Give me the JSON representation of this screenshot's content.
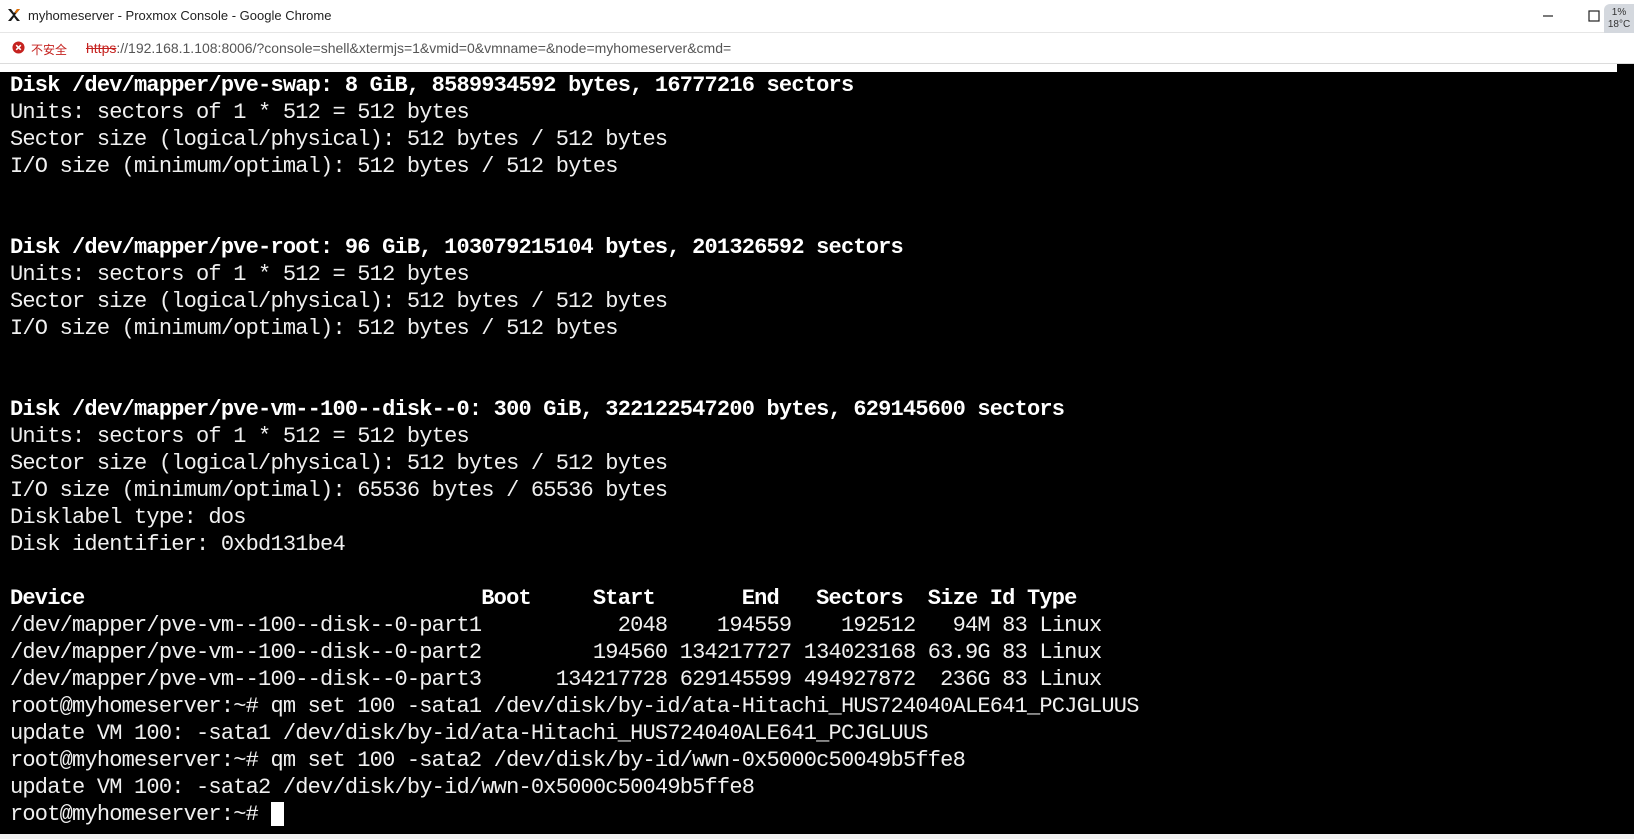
{
  "window": {
    "title": "myhomeserver - Proxmox Console - Google Chrome"
  },
  "weather": {
    "line1": "1%",
    "line2": "18°C"
  },
  "addressbar": {
    "security_label": "不安全",
    "url_scheme": "https",
    "url_rest": "://192.168.1.108:8006/?console=shell&xtermjs=1&vmid=0&vmname=&node=myhomeserver&cmd="
  },
  "terminal": {
    "lines": [
      {
        "text": "Disk /dev/mapper/pve-swap: 8 GiB, 8589934592 bytes, 16777216 sectors",
        "bold": true
      },
      {
        "text": "Units: sectors of 1 * 512 = 512 bytes",
        "bold": false
      },
      {
        "text": "Sector size (logical/physical): 512 bytes / 512 bytes",
        "bold": false
      },
      {
        "text": "I/O size (minimum/optimal): 512 bytes / 512 bytes",
        "bold": false
      },
      {
        "text": "",
        "bold": false
      },
      {
        "text": "",
        "bold": false
      },
      {
        "text": "Disk /dev/mapper/pve-root: 96 GiB, 103079215104 bytes, 201326592 sectors",
        "bold": true
      },
      {
        "text": "Units: sectors of 1 * 512 = 512 bytes",
        "bold": false
      },
      {
        "text": "Sector size (logical/physical): 512 bytes / 512 bytes",
        "bold": false
      },
      {
        "text": "I/O size (minimum/optimal): 512 bytes / 512 bytes",
        "bold": false
      },
      {
        "text": "",
        "bold": false
      },
      {
        "text": "",
        "bold": false
      },
      {
        "text": "Disk /dev/mapper/pve-vm--100--disk--0: 300 GiB, 322122547200 bytes, 629145600 sectors",
        "bold": true
      },
      {
        "text": "Units: sectors of 1 * 512 = 512 bytes",
        "bold": false
      },
      {
        "text": "Sector size (logical/physical): 512 bytes / 512 bytes",
        "bold": false
      },
      {
        "text": "I/O size (minimum/optimal): 65536 bytes / 65536 bytes",
        "bold": false
      },
      {
        "text": "Disklabel type: dos",
        "bold": false
      },
      {
        "text": "Disk identifier: 0xbd131be4",
        "bold": false
      },
      {
        "text": "",
        "bold": false
      },
      {
        "text": "Device                                Boot     Start       End   Sectors  Size Id Type",
        "bold": true
      },
      {
        "text": "/dev/mapper/pve-vm--100--disk--0-part1           2048    194559    192512   94M 83 Linux",
        "bold": false
      },
      {
        "text": "/dev/mapper/pve-vm--100--disk--0-part2         194560 134217727 134023168 63.9G 83 Linux",
        "bold": false
      },
      {
        "text": "/dev/mapper/pve-vm--100--disk--0-part3      134217728 629145599 494927872  236G 83 Linux",
        "bold": false
      },
      {
        "text": "root@myhomeserver:~# qm set 100 -sata1 /dev/disk/by-id/ata-Hitachi_HUS724040ALE641_PCJGLUUS",
        "bold": false
      },
      {
        "text": "update VM 100: -sata1 /dev/disk/by-id/ata-Hitachi_HUS724040ALE641_PCJGLUUS",
        "bold": false
      },
      {
        "text": "root@myhomeserver:~# qm set 100 -sata2 /dev/disk/by-id/wwn-0x5000c50049b5ffe8",
        "bold": false
      },
      {
        "text": "update VM 100: -sata2 /dev/disk/by-id/wwn-0x5000c50049b5ffe8",
        "bold": false
      }
    ],
    "prompt": "root@myhomeserver:~# "
  },
  "colors": {
    "terminal_bg": "#000000",
    "terminal_fg": "#f0f0f0",
    "insecure_red": "#c5221f"
  },
  "icons": {
    "app": "proxmox-x-icon",
    "security": "not-secure-icon",
    "minimize": "minimize-icon",
    "maximize": "maximize-icon"
  }
}
